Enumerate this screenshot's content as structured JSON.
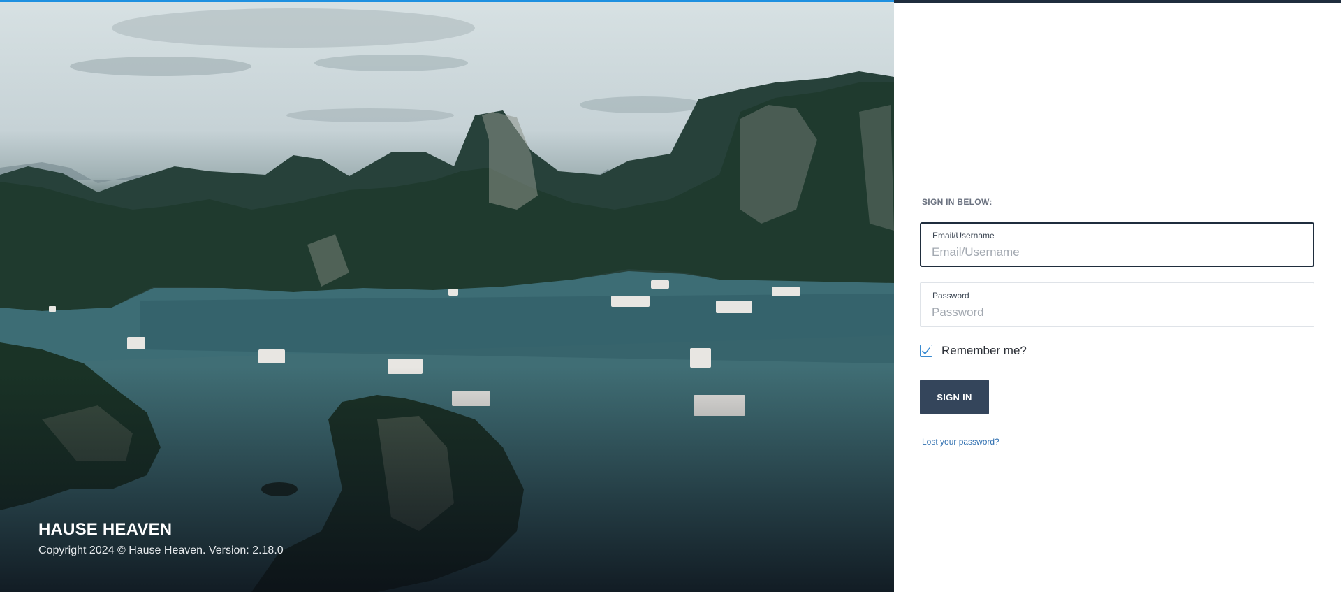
{
  "hero": {
    "brand_title": "HAUSE HEAVEN",
    "copyright": "Copyright 2024 © Hause Heaven. Version: 2.18.0",
    "accent_color": "#1e90e0"
  },
  "login": {
    "heading": "SIGN IN BELOW:",
    "email": {
      "label": "Email/Username",
      "placeholder": "Email/Username",
      "value": ""
    },
    "password": {
      "label": "Password",
      "placeholder": "Password",
      "value": ""
    },
    "remember": {
      "label": "Remember me?",
      "checked": true
    },
    "submit_label": "SIGN IN",
    "lost_password": "Lost your password?",
    "colors": {
      "button": "#34455b",
      "link": "#2f6fb0",
      "checkbox": "#3a8ad0"
    }
  },
  "icons": {
    "checkbox": "check-icon"
  }
}
